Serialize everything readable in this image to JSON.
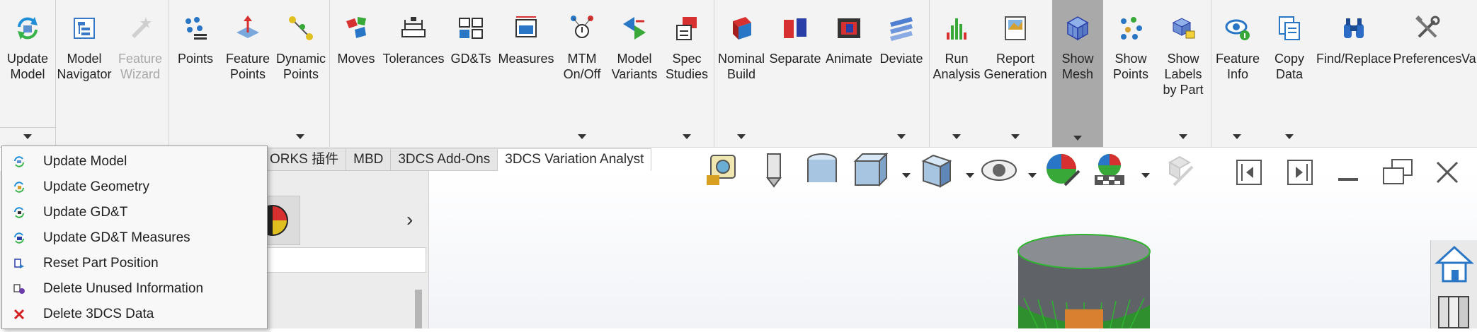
{
  "ribbon": {
    "buttons": [
      {
        "id": "update-model",
        "label": "Update\nModel",
        "icon": "update-model-icon",
        "enabled": true,
        "active": false,
        "dropdown": true
      },
      {
        "id": "model-navigator",
        "label": "Model\nNavigator",
        "icon": "model-navigator-icon",
        "enabled": true,
        "active": false,
        "dropdown": false
      },
      {
        "id": "feature-wizard",
        "label": "Feature\nWizard",
        "icon": "feature-wizard-icon",
        "enabled": false,
        "active": false,
        "dropdown": false
      },
      {
        "id": "points",
        "label": "Points",
        "icon": "points-icon",
        "enabled": true,
        "active": false,
        "dropdown": false
      },
      {
        "id": "feature-points",
        "label": "Feature\nPoints",
        "icon": "feature-points-icon",
        "enabled": true,
        "active": false,
        "dropdown": false
      },
      {
        "id": "dynamic-points",
        "label": "Dynamic\nPoints",
        "icon": "dynamic-points-icon",
        "enabled": true,
        "active": false,
        "dropdown": true
      },
      {
        "id": "moves",
        "label": "Moves",
        "icon": "moves-icon",
        "enabled": true,
        "active": false,
        "dropdown": false
      },
      {
        "id": "tolerances",
        "label": "Tolerances",
        "icon": "tolerances-icon",
        "enabled": true,
        "active": false,
        "dropdown": false
      },
      {
        "id": "gdts",
        "label": "GD&Ts",
        "icon": "gdts-icon",
        "enabled": true,
        "active": false,
        "dropdown": false
      },
      {
        "id": "measures",
        "label": "Measures",
        "icon": "measures-icon",
        "enabled": true,
        "active": false,
        "dropdown": false
      },
      {
        "id": "mtm-onoff",
        "label": "MTM\nOn/Off",
        "icon": "mtm-icon",
        "enabled": true,
        "active": false,
        "dropdown": true
      },
      {
        "id": "model-variants",
        "label": "Model\nVariants",
        "icon": "model-variants-icon",
        "enabled": true,
        "active": false,
        "dropdown": false
      },
      {
        "id": "spec-studies",
        "label": "Spec\nStudies",
        "icon": "spec-studies-icon",
        "enabled": true,
        "active": false,
        "dropdown": true
      },
      {
        "id": "nominal-build",
        "label": "Nominal\nBuild",
        "icon": "nominal-build-icon",
        "enabled": true,
        "active": false,
        "dropdown": true
      },
      {
        "id": "separate",
        "label": "Separate",
        "icon": "separate-icon",
        "enabled": true,
        "active": false,
        "dropdown": false
      },
      {
        "id": "animate",
        "label": "Animate",
        "icon": "animate-icon",
        "enabled": true,
        "active": false,
        "dropdown": false
      },
      {
        "id": "deviate",
        "label": "Deviate",
        "icon": "deviate-icon",
        "enabled": true,
        "active": false,
        "dropdown": true
      },
      {
        "id": "run-analysis",
        "label": "Run\nAnalysis",
        "icon": "run-analysis-icon",
        "enabled": true,
        "active": false,
        "dropdown": true
      },
      {
        "id": "report-generation",
        "label": "Report\nGeneration",
        "icon": "report-generation-icon",
        "enabled": true,
        "active": false,
        "dropdown": true
      },
      {
        "id": "show-mesh",
        "label": "Show\nMesh",
        "icon": "show-mesh-icon",
        "enabled": true,
        "active": true,
        "dropdown": true
      },
      {
        "id": "show-points",
        "label": "Show\nPoints",
        "icon": "show-points-icon",
        "enabled": true,
        "active": false,
        "dropdown": false
      },
      {
        "id": "show-labels-by-part",
        "label": "Show\nLabels\nby Part",
        "icon": "show-labels-icon",
        "enabled": true,
        "active": false,
        "dropdown": true
      },
      {
        "id": "feature-info",
        "label": "Feature\nInfo",
        "icon": "feature-info-icon",
        "enabled": true,
        "active": false,
        "dropdown": true
      },
      {
        "id": "copy-data",
        "label": "Copy\nData",
        "icon": "copy-data-icon",
        "enabled": true,
        "active": false,
        "dropdown": true
      },
      {
        "id": "find-replace",
        "label": "Find/Replace",
        "icon": "find-replace-icon",
        "enabled": true,
        "active": false,
        "dropdown": false
      },
      {
        "id": "preferences",
        "label": "Preferences",
        "icon": "preferences-icon",
        "enabled": true,
        "active": false,
        "dropdown": false
      },
      {
        "id": "validate",
        "label": "Va",
        "icon": "validate-icon",
        "enabled": true,
        "active": false,
        "dropdown": false
      }
    ]
  },
  "tabs": [
    {
      "label": "ORKS 插件",
      "active": false
    },
    {
      "label": "MBD",
      "active": false
    },
    {
      "label": "3DCS Add-Ons",
      "active": false
    },
    {
      "label": "3DCS Variation Analyst",
      "active": true
    }
  ],
  "menu": {
    "items": [
      {
        "label": "Update Model",
        "icon": "update-model-icon"
      },
      {
        "label": "Update Geometry",
        "icon": "update-geometry-icon"
      },
      {
        "label": "Update GD&T",
        "icon": "update-gdt-icon"
      },
      {
        "label": "Update GD&T Measures",
        "icon": "update-gdt-measures-icon"
      },
      {
        "label": "Reset Part Position",
        "icon": "reset-part-position-icon"
      },
      {
        "label": "Delete Unused Information",
        "icon": "delete-unused-icon"
      },
      {
        "label": "Delete 3DCS Data",
        "icon": "delete-3dcs-icon"
      }
    ]
  },
  "colors": {
    "ribbon_bg": "#f3f3f3",
    "active_button": "#a9a9a9",
    "delete_red": "#d62020",
    "mesh_gray": "#6b6b6b",
    "mesh_green": "#2fb52f"
  }
}
